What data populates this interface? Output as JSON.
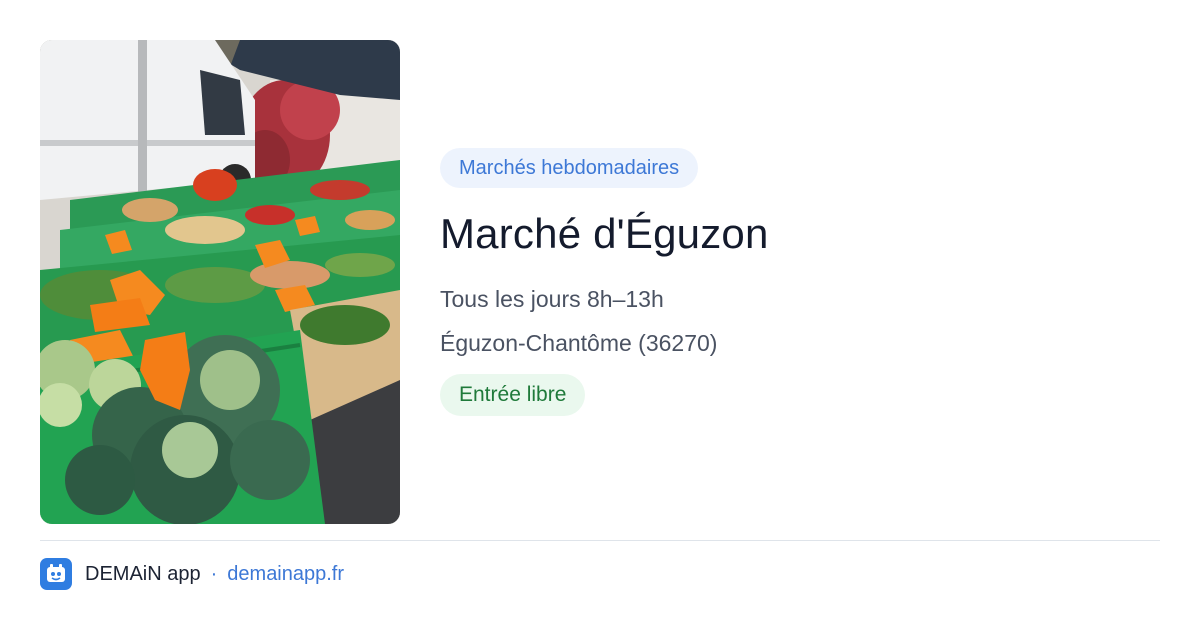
{
  "listing": {
    "category": "Marchés hebdomadaires",
    "title": "Marché d'Éguzon",
    "schedule": "Tous les jours 8h–13h",
    "location": "Éguzon-Chantôme (36270)",
    "entry": "Entrée libre"
  },
  "footer": {
    "app_name": "DEMAiN app",
    "separator": "·",
    "url": "demainapp.fr",
    "logo_icon": "app-logo-icon"
  },
  "photo": {
    "description_icon": "market-stall-photo"
  },
  "colors": {
    "accent_blue": "#3d78d6",
    "chip_blue_bg": "#edf3fd",
    "chip_green_bg": "#eaf8ee",
    "chip_green_text": "#1f7a3a",
    "title": "#141b2d"
  }
}
